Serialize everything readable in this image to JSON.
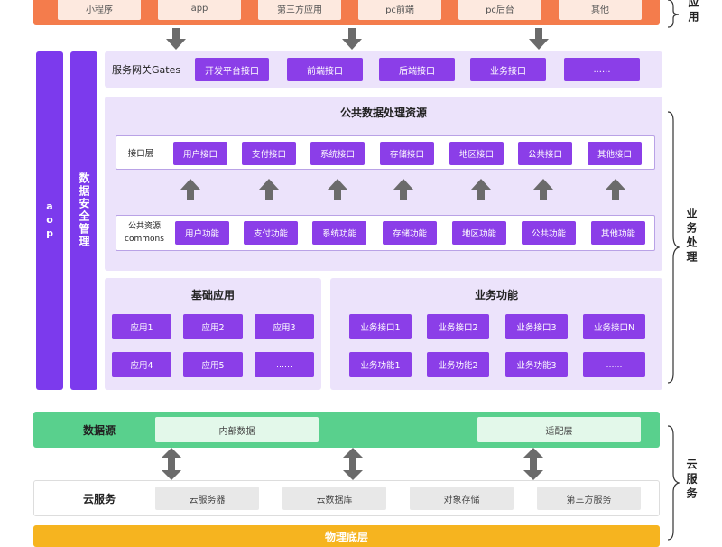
{
  "top_layer": {
    "side_label": "应用",
    "items": [
      "小程序",
      "app",
      "第三方应用",
      "pc前端",
      "pc后台",
      "其他"
    ]
  },
  "left_bars": {
    "aop": "aop",
    "security": "数据安全管理"
  },
  "gateway": {
    "title": "服务网关Gates",
    "items": [
      "开发平台接口",
      "前端接口",
      "后端接口",
      "业务接口",
      "......"
    ]
  },
  "public_data": {
    "title": "公共数据处理资源",
    "interface_label": "接口层",
    "interfaces": [
      "用户接口",
      "支付接口",
      "系统接口",
      "存储接口",
      "地区接口",
      "公共接口",
      "其他接口"
    ],
    "commons_label_line1": "公共资源",
    "commons_label_line2": "commons",
    "commons": [
      "用户功能",
      "支付功能",
      "系统功能",
      "存储功能",
      "地区功能",
      "公共功能",
      "其他功能"
    ]
  },
  "base_app": {
    "title": "基础应用",
    "items": [
      "应用1",
      "应用2",
      "应用3",
      "应用4",
      "应用5",
      "......"
    ]
  },
  "business": {
    "title": "业务功能",
    "items": [
      "业务接口1",
      "业务接口2",
      "业务接口3",
      "业务接口N",
      "业务功能1",
      "业务功能2",
      "业务功能3",
      "......"
    ]
  },
  "business_side_label": "业务处理",
  "datasource": {
    "title": "数据源",
    "items": [
      "内部数据",
      "适配层"
    ]
  },
  "cloud": {
    "title": "云服务",
    "items": [
      "云服务器",
      "云数据库",
      "对象存储",
      "第三方服务"
    ],
    "side_label": "云服务"
  },
  "physical": {
    "title": "物理底层"
  },
  "colors": {
    "orange": "#f47c4c",
    "purple": "#8b3ee8",
    "panel": "#ece3fb",
    "green": "#59d08d",
    "yellow": "#f6b41f",
    "arrow": "#6b6b6b"
  }
}
